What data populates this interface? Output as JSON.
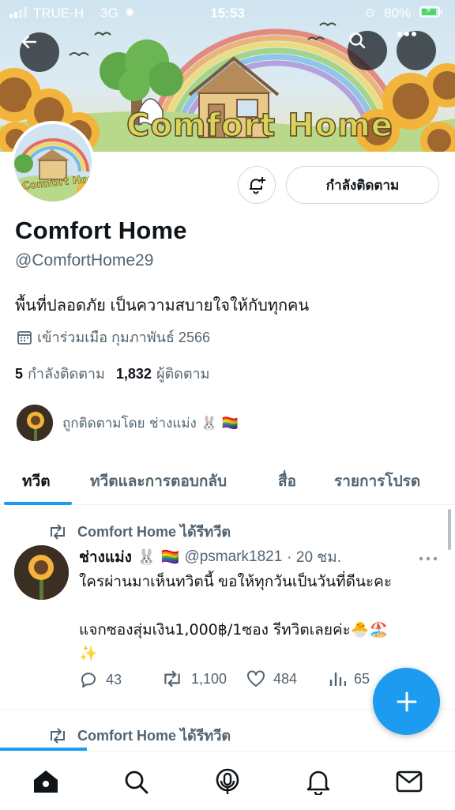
{
  "status_bar": {
    "carrier": "TRUE-H",
    "network": "3G",
    "time": "15:53",
    "battery": "80%",
    "battery_level": 0.8
  },
  "header": {
    "banner_text": "Comfort Home"
  },
  "profile": {
    "avatar_text": "Comfort Home",
    "display_name": "Comfort Home",
    "handle": "@ComfortHome29",
    "bio": "พื้นที่ปลอดภัย เป็นความสบายใจให้กับทุกคน",
    "joined": "เข้าร่วมเมือ กุมภาพันธ์ 2566",
    "following_count": "5",
    "following_label": "กำลังติดตาม",
    "followers_count": "1,832",
    "followers_label": "ผู้ติดตาม",
    "followed_by": "ถูกติดตามโดย ช่างแม่ง 🐰 🏳️‍🌈",
    "follow_button": "กำลังติดตาม"
  },
  "tabs": [
    {
      "label": "ทวีต",
      "active": true
    },
    {
      "label": "ทวีตและการตอบกลับ",
      "active": false
    },
    {
      "label": "สื่อ",
      "active": false
    },
    {
      "label": "รายการโปรด",
      "active": false
    }
  ],
  "tweet": {
    "retweet_label": "Comfort Home ได้รีทวีต",
    "author": "ช่างแม่ง 🐰 🏳️‍🌈",
    "handle": "@psmark1821",
    "time": "· 20 ชม.",
    "line1": "ใครผ่านมาเห็นทวิตนี้ ขอให้ทุกวันเป็นวันที่ดีนะคะ",
    "line2": "แจกซองสุ่มเงิน1,000฿/1ซอง รีทวิตเลยค่ะ🐣🏖️",
    "line3": "✨",
    "replies": "43",
    "retweets": "1,100",
    "likes": "484",
    "views": "65"
  },
  "next_tweet": {
    "retweet_label": "Comfort Home ได้รีทวีต"
  },
  "icons": {
    "back": "arrow-left-icon",
    "search": "search-icon",
    "more": "more-icon",
    "notify": "bell-plus-icon",
    "calendar": "calendar-icon",
    "retweet": "retweet-icon",
    "reply": "reply-icon",
    "like": "heart-icon",
    "views": "views-icon",
    "compose": "plus-icon",
    "nav": [
      "home-icon",
      "search-icon",
      "spaces-icon",
      "notifications-icon",
      "messages-icon"
    ]
  },
  "colors": {
    "accent": "#1d9bf0",
    "text": "#0f1419",
    "muted": "#536471",
    "border": "#cfd9de"
  }
}
